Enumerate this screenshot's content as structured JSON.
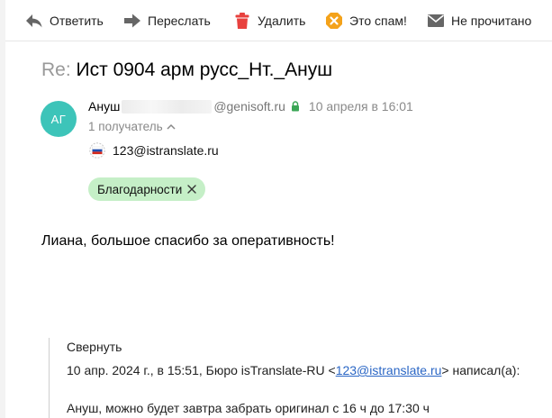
{
  "toolbar": {
    "reply_label": "Ответить",
    "forward_label": "Переслать",
    "delete_label": "Удалить",
    "spam_label": "Это спам!",
    "unread_label": "Не прочитано"
  },
  "message": {
    "subject_prefix": "Re:",
    "subject": "Ист 0904 арм русс_Нт._Ануш",
    "avatar_initials": "АГ",
    "sender_name_visible": "Ануш",
    "sender_domain": "@genisoft.ru",
    "date": "10 апреля в 16:01",
    "recipients_count": "1 получатель",
    "recipient_email": "123@istranslate.ru",
    "tag_label": "Благодарности",
    "body": "Лиана, большое спасибо за оперативность!"
  },
  "quote": {
    "collapse_label": "Свернуть",
    "header_prefix": "10 апр. 2024 г., в 15:51, Бюро isTranslate-RU <",
    "header_email": "123@istranslate.ru",
    "header_suffix": "> написал(а):",
    "text": "Ануш, можно будет завтра забрать оригинал с 16 ч до 17:30 ч"
  },
  "colors": {
    "avatar_bg": "#3dc4b9",
    "tag_bg": "#c5efc7",
    "link": "#2a66c5",
    "delete_icon": "#e8413e",
    "spam_icon": "#f4a21a",
    "lock_icon": "#3aa655"
  },
  "icons": {
    "reply": "reply-arrow-icon",
    "forward": "forward-arrow-icon",
    "delete": "trash-icon",
    "spam": "spam-warning-icon",
    "unread": "envelope-icon",
    "lock": "lock-icon",
    "chevron": "chevron-up-icon",
    "flag": "russia-flag-icon",
    "close": "close-icon"
  }
}
